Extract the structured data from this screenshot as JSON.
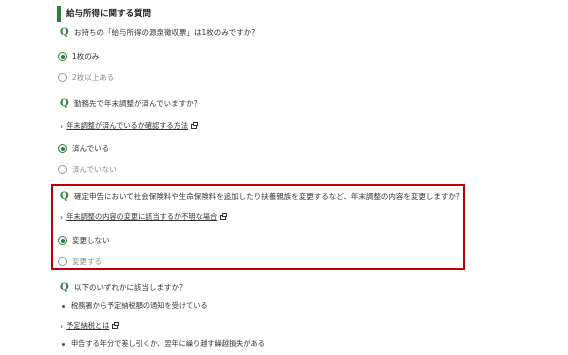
{
  "section_title": "給与所得に関する質問",
  "q_mark": "Q",
  "questions": [
    {
      "text": "お持ちの「給与所得の源泉徴収票」は1枚のみですか？",
      "options": [
        {
          "label": "1枚のみ",
          "checked": true
        },
        {
          "label": "2枚以上ある",
          "checked": false
        }
      ]
    },
    {
      "text": "勤務先で年末調整が済んでいますか？",
      "link": "年末調整が済んでいるか確認する方法",
      "options": [
        {
          "label": "済んでいる",
          "checked": true
        },
        {
          "label": "済んでいない",
          "checked": false
        }
      ]
    },
    {
      "text": "確定申告において社会保険料や生命保険料を追加したり扶養親族を変更するなど、年末調整の内容を変更しますか？",
      "link": "年末調整の内容の変更に該当するか不明な場合",
      "options": [
        {
          "label": "変更しない",
          "checked": true
        },
        {
          "label": "変更する",
          "checked": false
        }
      ]
    },
    {
      "text": "以下のいずれかに該当しますか？",
      "bullets": [
        "税務署から予定納税額の通知を受けている",
        "申告する年分で差し引くか、翌年に繰り越す繰越損失がある"
      ],
      "link": "予定納税とは"
    }
  ],
  "colors": {
    "accent": "#2e7d3a",
    "highlight_border": "#c00000"
  }
}
